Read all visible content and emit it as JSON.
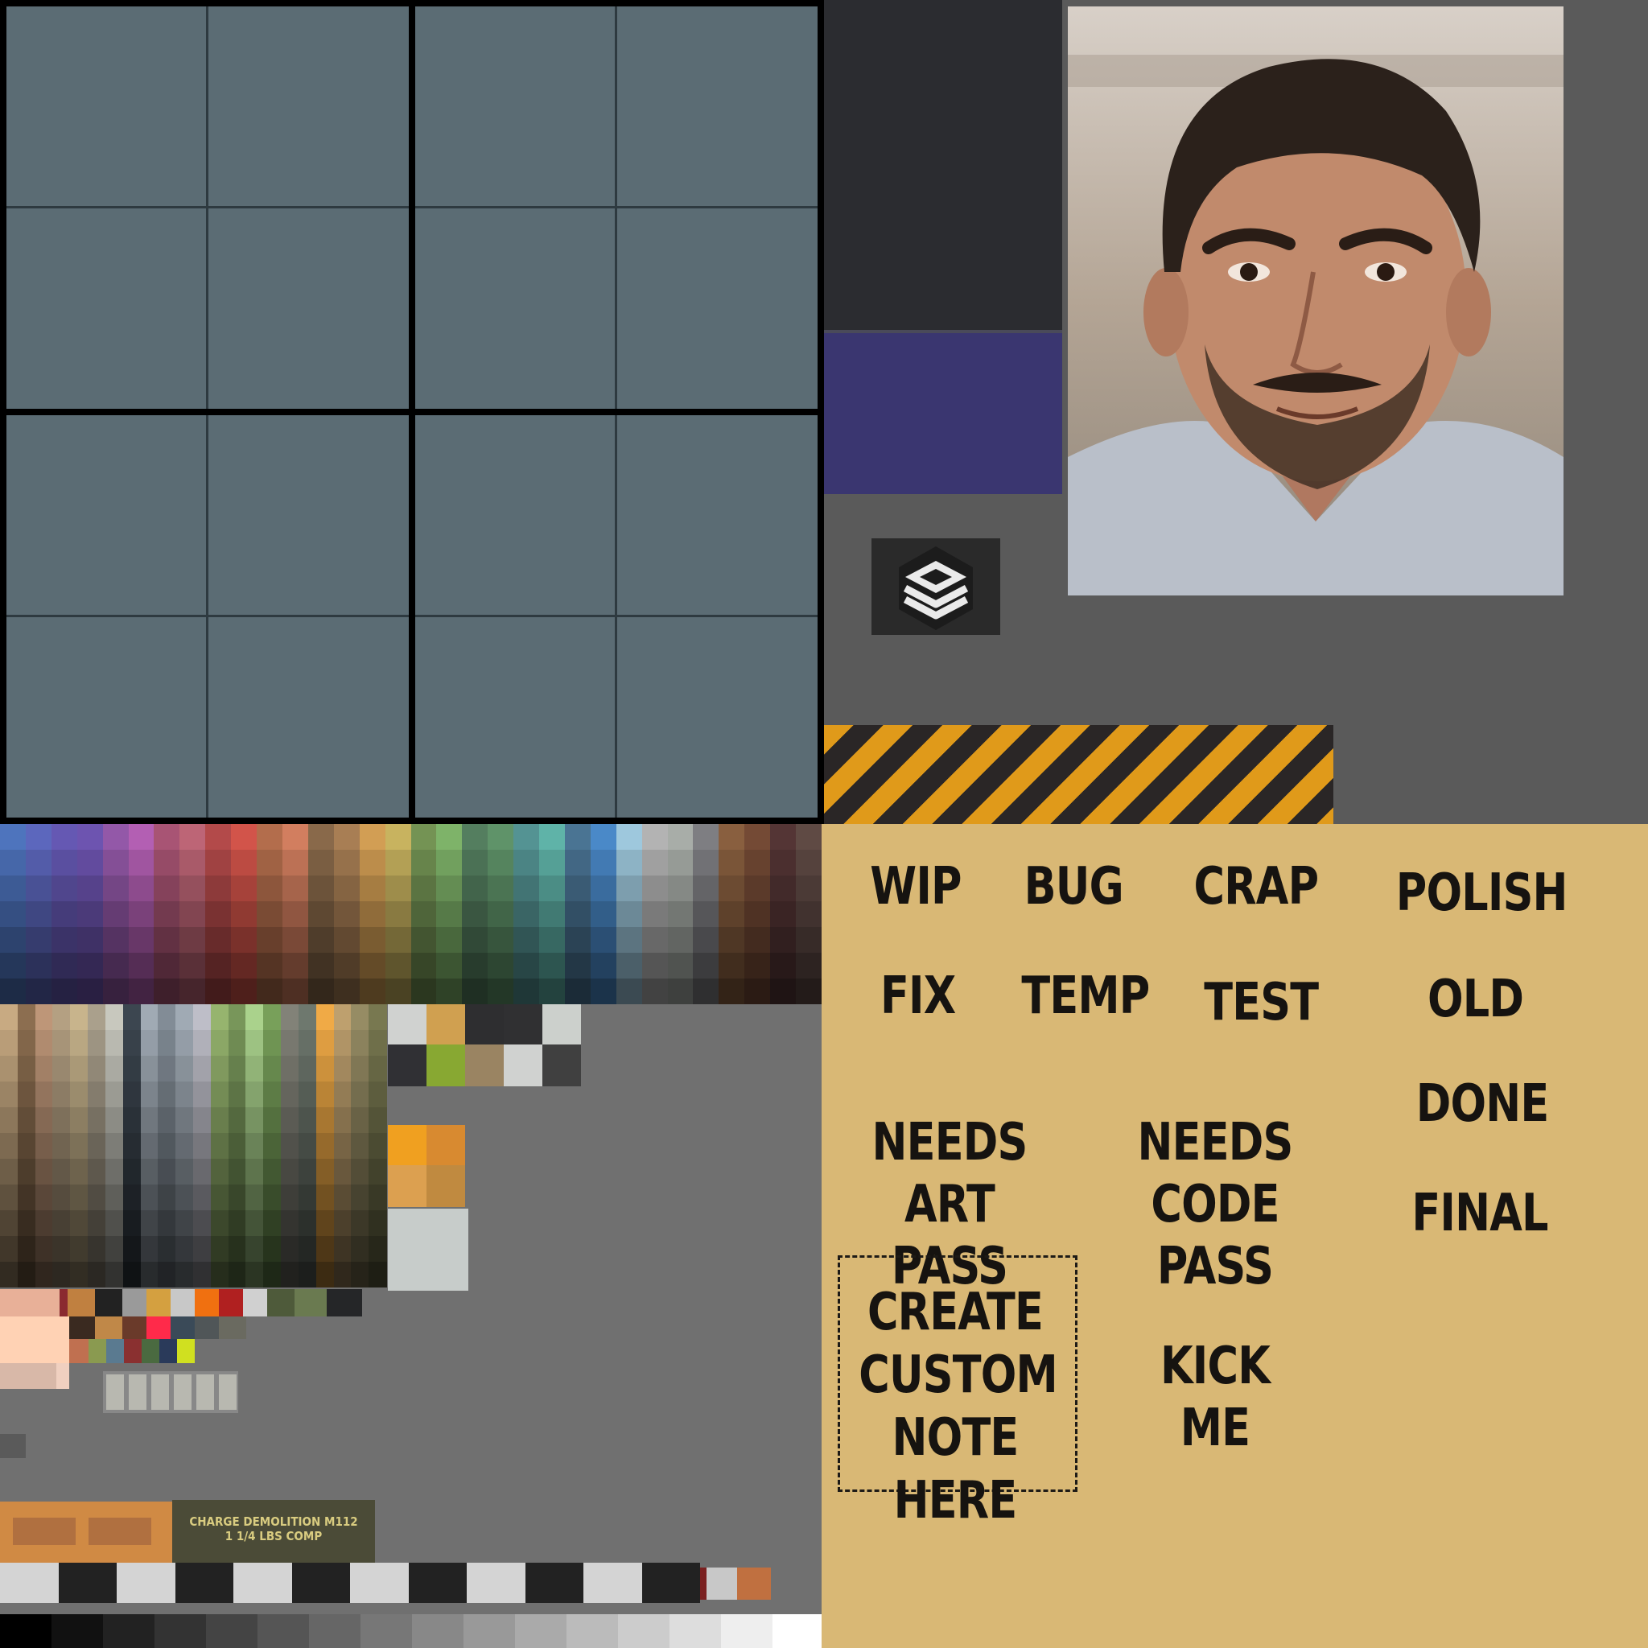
{
  "notes": {
    "wip": "WIP",
    "bug": "BUG",
    "crap": "CRAP",
    "polish": "POLISH",
    "fix": "FIX",
    "temp": "TEMP",
    "test": "TEST",
    "old": "OLD",
    "done": "DONE",
    "needs_art_line1": "NEEDS",
    "needs_art_line2": "ART PASS",
    "needs_code_line1": "NEEDS",
    "needs_code_line2": "CODE PASS",
    "final": "FINAL",
    "custom_line1": "CREATE",
    "custom_line2": "CUSTOM",
    "custom_line3": "NOTE HERE",
    "kick_me": "KICK ME"
  },
  "label_plate": {
    "line1": "CHARGE DEMOLITION M112",
    "line2": "1 1/4 LBS COMP"
  },
  "colors": {
    "grid_cell": "#5b6c74",
    "notes_bg": "#d9b875",
    "hazard_yellow": "#e09a1a",
    "hazard_dark": "#2a2626",
    "purple": "#3a3670"
  },
  "icons": {
    "logo": "layers-logo-icon",
    "photo": "person-portrait"
  }
}
